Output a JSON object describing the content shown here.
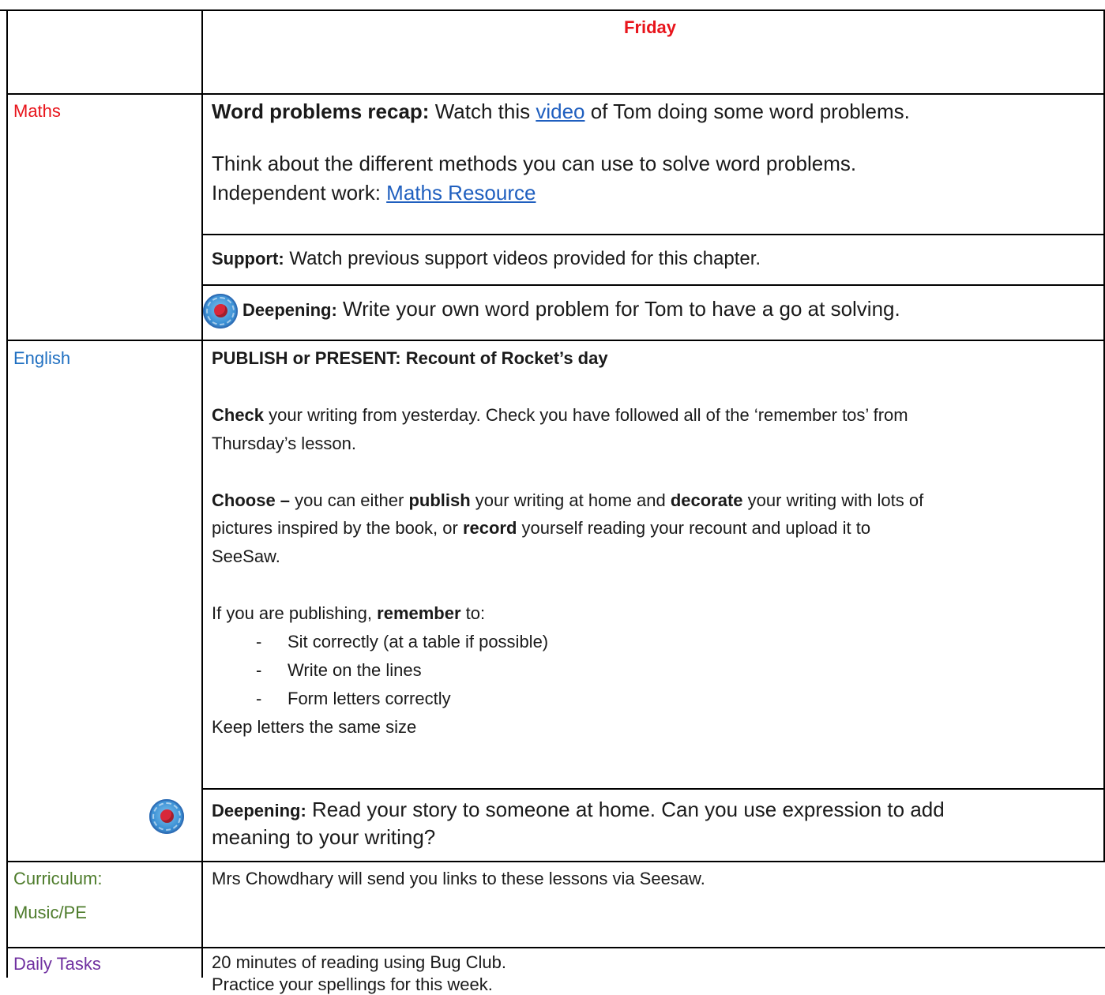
{
  "header": {
    "day": "Friday"
  },
  "colors": {
    "maths": "#e8141b",
    "english": "#1f6fc1",
    "curriculum": "#4e7c2c",
    "daily": "#7030a0",
    "header": "#e8141b",
    "link": "#1f5fbf"
  },
  "maths": {
    "label": "Maths",
    "recap_title": "Word problems recap:",
    "recap_pre": " Watch this ",
    "recap_link": "video",
    "recap_post": " of Tom doing some word problems.",
    "think_line": "Think about the different methods you can use to solve word problems.",
    "independent_pre": "Independent work: ",
    "independent_link": "Maths Resource",
    "support_title": "Support:",
    "support_text": " Watch previous support videos provided for this chapter.",
    "deepening_title": "Deepening:",
    "deepening_text": " Write your own word problem for Tom to have a go at solving.",
    "badge_icon": "challenge-badge-icon"
  },
  "english": {
    "label": "English",
    "heading": "PUBLISH or PRESENT: Recount of Rocket’s day",
    "check_bold": "Check",
    "check_text_1": " your writing from yesterday. Check you have followed all of the ‘remember tos’ from",
    "check_text_2": "Thursday’s lesson.",
    "choose_bold": "Choose –",
    "choose_a": " you can either ",
    "choose_publish": "publish",
    "choose_b": " your writing at home and ",
    "choose_decorate": "decorate",
    "choose_c": " your writing with lots of",
    "choose_line2": "pictures inspired by the book, or ",
    "choose_record": "record",
    "choose_d": " yourself reading your recount and upload it to",
    "choose_line3": "SeeSaw.",
    "remember_pre": "If you are publishing, ",
    "remember_bold": "remember",
    "remember_post": " to:",
    "list": [
      "Sit correctly (at a table if possible)",
      "Write on the lines",
      "Form letters correctly"
    ],
    "list_dash": "-",
    "keep_line": "Keep letters the same size",
    "deepening_title": "Deepening:",
    "deepening_text_1": " Read your story to someone at home. Can you use expression to add",
    "deepening_text_2": "meaning to your writing?"
  },
  "curriculum": {
    "label_1": "Curriculum:",
    "label_2": "Music/PE",
    "text": "Mrs Chowdhary will send you links to these lessons via Seesaw."
  },
  "daily": {
    "label": "Daily Tasks",
    "line_1": "20 minutes of reading using Bug Club.",
    "line_2": "Practice your spellings for this week."
  }
}
